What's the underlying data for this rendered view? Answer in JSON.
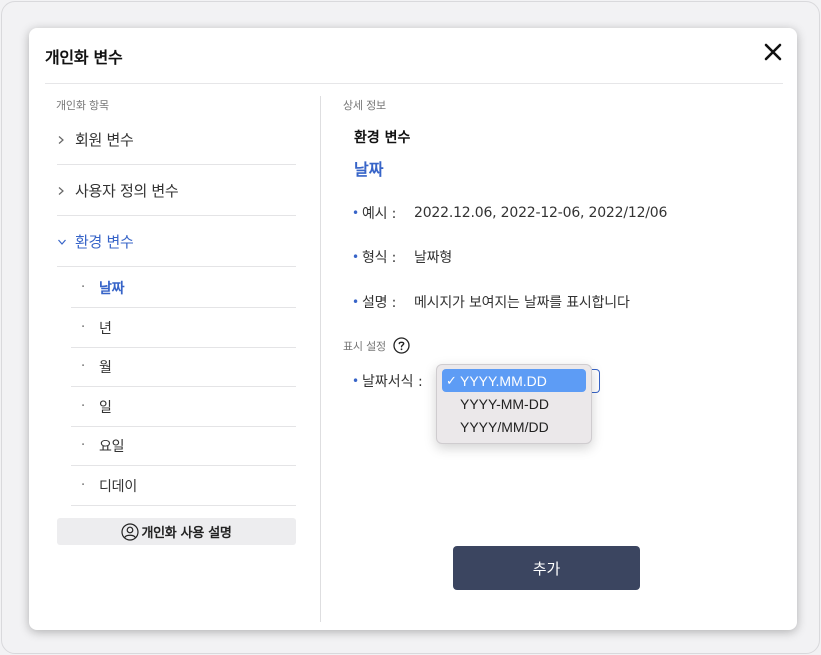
{
  "modal": {
    "title": "개인화 변수",
    "close_icon": "close-icon"
  },
  "left_panel": {
    "label": "개인화 항목",
    "categories": [
      {
        "label": "회원 변수",
        "expanded": false
      },
      {
        "label": "사용자 정의 변수",
        "expanded": false
      },
      {
        "label": "환경 변수",
        "expanded": true
      }
    ],
    "sub_items": [
      {
        "label": "날짜",
        "active": true
      },
      {
        "label": "년",
        "active": false
      },
      {
        "label": "월",
        "active": false
      },
      {
        "label": "일",
        "active": false
      },
      {
        "label": "요일",
        "active": false
      },
      {
        "label": "디데이",
        "active": false
      }
    ],
    "sub_bullet": "·",
    "guide_button": {
      "label": "개인화 사용 설명",
      "icon": "person-circle-icon"
    }
  },
  "right_panel": {
    "label": "상세 정보",
    "category_title": "환경 변수",
    "item_title": "날짜",
    "bullet": "•",
    "info": [
      {
        "key": "예시 :",
        "value": "2022.12.06, 2022-12-06, 2022/12/06"
      },
      {
        "key": "형식 :",
        "value": "날짜형"
      },
      {
        "key": "설명 :",
        "value": "메시지가 보여지는 날짜를 표시합니다"
      }
    ],
    "display_settings": {
      "label": "표시 설정",
      "help_icon": "question-circle-icon",
      "format_label": "날짜서식 :",
      "options": [
        "YYYY.MM.DD",
        "YYYY-MM-DD",
        "YYYY/MM/DD"
      ],
      "selected": "YYYY.MM.DD",
      "check_mark": "✓"
    },
    "add_button": "추가"
  },
  "colors": {
    "accent": "#3764c8",
    "button_dark": "#3b4560",
    "dropdown_highlight": "#5d9cf5"
  }
}
